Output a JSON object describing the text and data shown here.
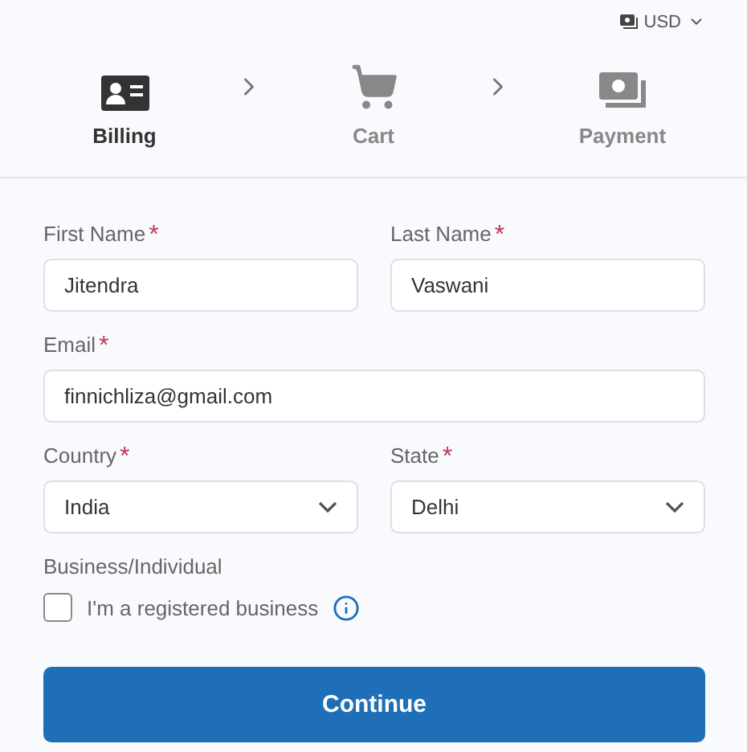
{
  "currency": {
    "label": "USD"
  },
  "steps": [
    {
      "label": "Billing",
      "selected": true
    },
    {
      "label": "Cart",
      "selected": false
    },
    {
      "label": "Payment",
      "selected": false
    }
  ],
  "form": {
    "rows": [
      [
        {
          "kind": "text",
          "label": "First Name",
          "mark": "*",
          "value": "Jitendra"
        },
        {
          "kind": "text",
          "label": "Last Name",
          "mark": "*",
          "value": "Vaswani"
        }
      ],
      [
        {
          "kind": "text",
          "label": "Email",
          "mark": "*",
          "value": "finnichliza@gmail.com"
        }
      ],
      [
        {
          "kind": "select",
          "label": "Country",
          "mark": "*",
          "value": "India"
        },
        {
          "kind": "select",
          "label": "State",
          "mark": "*",
          "value": "Delhi"
        }
      ]
    ],
    "business": {
      "label": "Business/Individual",
      "checkbox": {
        "label": "I'm a registered business",
        "checked": false
      }
    },
    "submit": "Continue"
  }
}
